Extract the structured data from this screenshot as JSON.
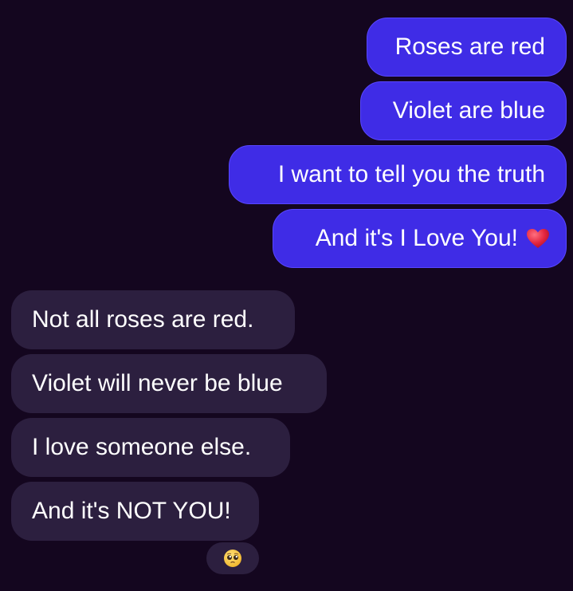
{
  "conversation": {
    "sent": [
      {
        "text": "Roses are red"
      },
      {
        "text": "Violet are blue"
      },
      {
        "text": "I want to tell you the truth"
      },
      {
        "text": "And it's I Love You!",
        "emoji": "red-heart"
      }
    ],
    "received": [
      {
        "text": "Not all roses are red."
      },
      {
        "text": "Violet will never be blue"
      },
      {
        "text": "I love someone else."
      },
      {
        "text": "And it's NOT YOU!"
      }
    ],
    "reaction": {
      "emoji": "pleading-face"
    }
  },
  "colors": {
    "background": "#14061f",
    "sent_bubble": "#3f2ce6",
    "received_bubble": "#2c1f3f",
    "text": "#ffffff",
    "heart": "#e3263f"
  }
}
